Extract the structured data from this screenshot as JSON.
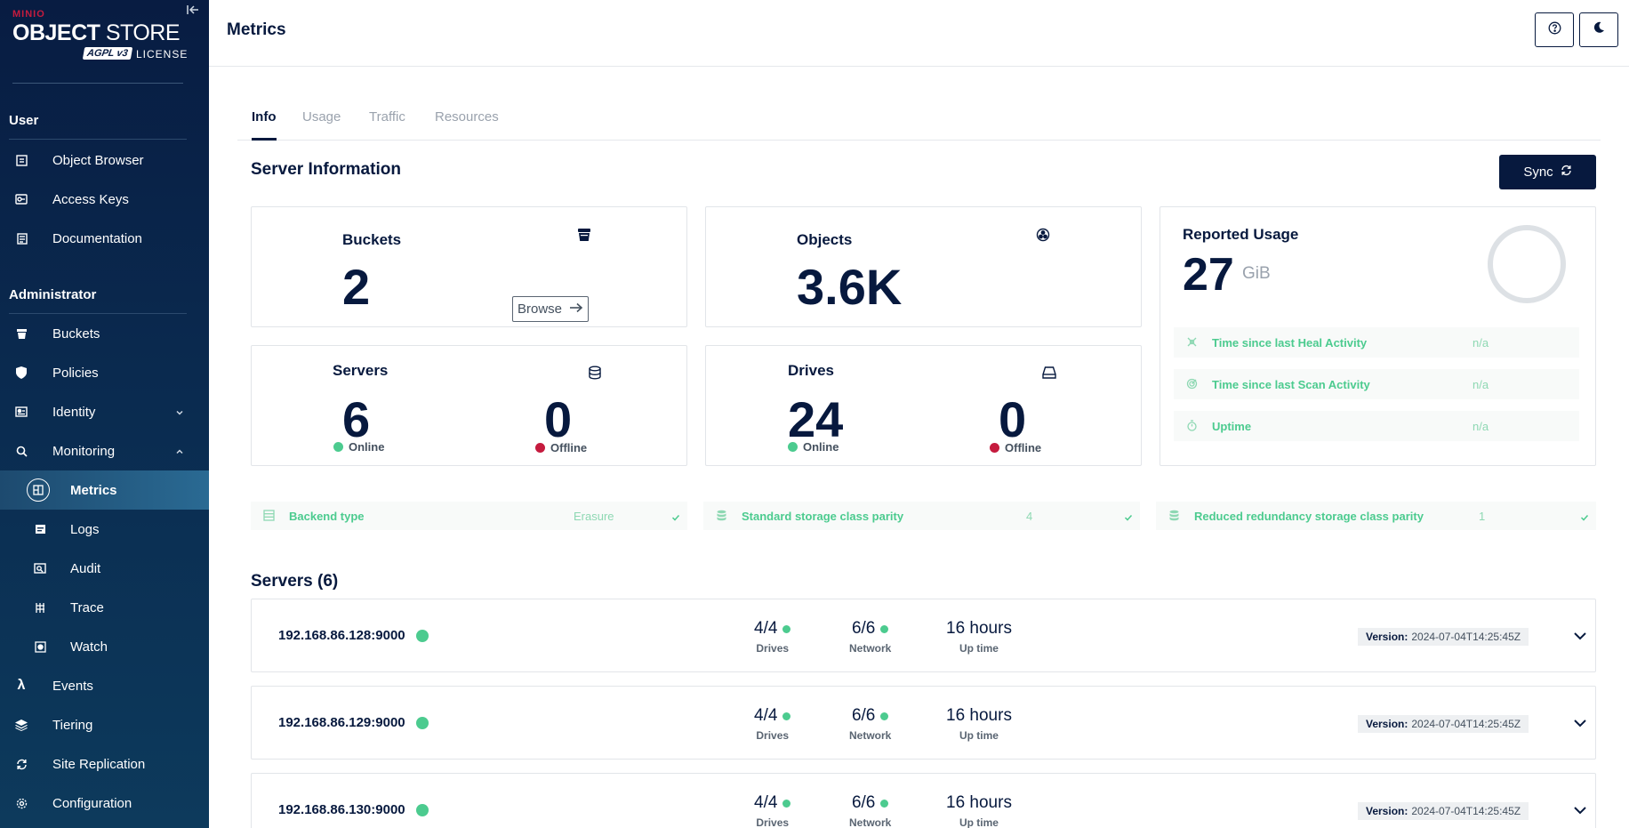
{
  "sidebar": {
    "brand": "MINIO",
    "logo_title_bold": "OBJECT",
    "logo_title_rest": " STORE",
    "agpl": "AGPL v3",
    "license": "LICENSE",
    "sections": {
      "user": "User",
      "administrator": "Administrator"
    },
    "user_items": [
      {
        "label": "Object Browser",
        "icon": "object-browser-icon"
      },
      {
        "label": "Access Keys",
        "icon": "key-icon"
      },
      {
        "label": "Documentation",
        "icon": "document-icon"
      }
    ],
    "admin_items": [
      {
        "label": "Buckets",
        "icon": "bucket-icon"
      },
      {
        "label": "Policies",
        "icon": "policy-icon"
      },
      {
        "label": "Identity",
        "icon": "identity-icon"
      },
      {
        "label": "Monitoring",
        "icon": "search-icon"
      },
      {
        "label": "Metrics",
        "icon": "metrics-icon"
      },
      {
        "label": "Logs",
        "icon": "logs-icon"
      },
      {
        "label": "Audit",
        "icon": "audit-icon"
      },
      {
        "label": "Trace",
        "icon": "trace-icon"
      },
      {
        "label": "Watch",
        "icon": "watch-icon"
      },
      {
        "label": "Events",
        "icon": "lambda-icon"
      },
      {
        "label": "Tiering",
        "icon": "tiering-icon"
      },
      {
        "label": "Site Replication",
        "icon": "replication-icon"
      },
      {
        "label": "Configuration",
        "icon": "gear-icon"
      }
    ]
  },
  "header": {
    "title": "Metrics"
  },
  "tabs": [
    {
      "label": "Info",
      "active": true
    },
    {
      "label": "Usage",
      "active": false
    },
    {
      "label": "Traffic",
      "active": false
    },
    {
      "label": "Resources",
      "active": false
    }
  ],
  "server_info": {
    "heading": "Server Information",
    "sync_label": "Sync",
    "buckets": {
      "label": "Buckets",
      "value": "2",
      "browse_label": "Browse"
    },
    "objects": {
      "label": "Objects",
      "value": "3.6K"
    },
    "servers": {
      "label": "Servers",
      "online": "6",
      "offline": "0",
      "online_label": "Online",
      "offline_label": "Offline"
    },
    "drives": {
      "label": "Drives",
      "online": "24",
      "offline": "0",
      "online_label": "Online",
      "offline_label": "Offline"
    },
    "reported_usage": {
      "label": "Reported Usage",
      "value": "27",
      "unit": "GiB",
      "rows": [
        {
          "label": "Time since last Heal Activity",
          "value": "n/a"
        },
        {
          "label": "Time since last Scan Activity",
          "value": "n/a"
        },
        {
          "label": "Uptime",
          "value": "n/a"
        }
      ]
    },
    "backend": [
      {
        "label": "Backend type",
        "value": "Erasure"
      },
      {
        "label": "Standard storage class parity",
        "value": "4"
      },
      {
        "label": "Reduced redundancy storage class parity",
        "value": "1"
      }
    ]
  },
  "servers_list": {
    "heading": "Servers (6)",
    "drives_label": "Drives",
    "network_label": "Network",
    "uptime_label": "Up time",
    "version_label": "Version:",
    "rows": [
      {
        "address": "192.168.86.128:9000",
        "drives": "4/4",
        "network": "6/6",
        "uptime": "16 hours",
        "version": "2024-07-04T14:25:45Z"
      },
      {
        "address": "192.168.86.129:9000",
        "drives": "4/4",
        "network": "6/6",
        "uptime": "16 hours",
        "version": "2024-07-04T14:25:45Z"
      },
      {
        "address": "192.168.86.130:9000",
        "drives": "4/4",
        "network": "6/6",
        "uptime": "16 hours",
        "version": "2024-07-04T14:25:45Z"
      }
    ]
  },
  "colors": {
    "navy": "#07193e",
    "green": "#4ccb8f",
    "red": "#c51b3e"
  }
}
